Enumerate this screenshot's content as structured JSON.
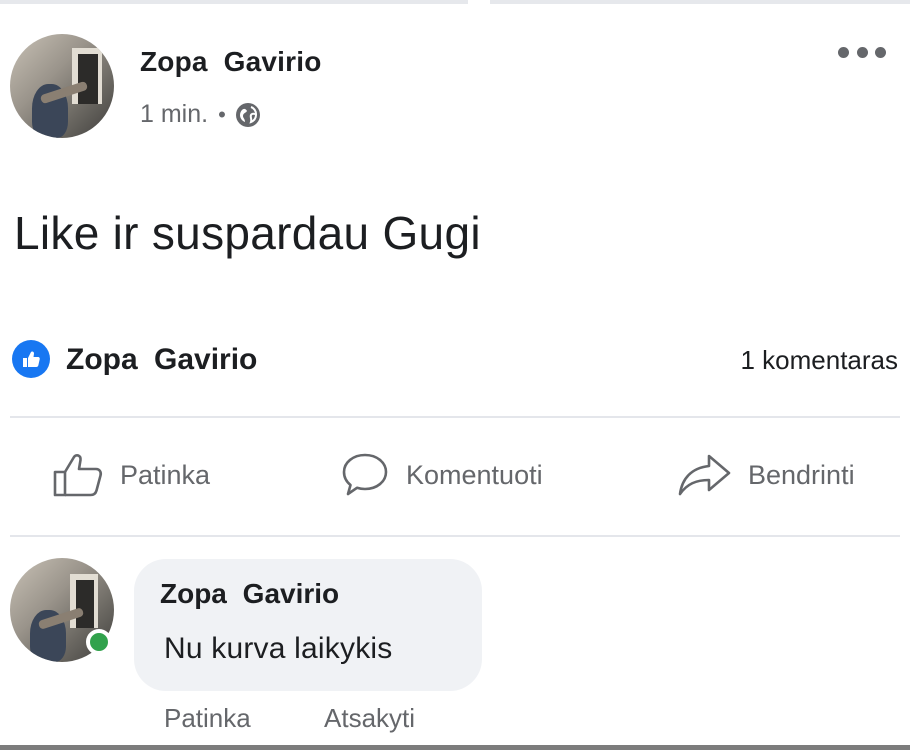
{
  "post": {
    "author": "Zopa Gavirio",
    "time": "1 min.",
    "separator": "•",
    "privacy_icon": "globe-icon",
    "text": "Like ir suspardau Gugi",
    "more_icon": "more-options-icon"
  },
  "reactions": {
    "icon": "like-badge-icon",
    "names": "Zopa Gavirio",
    "comment_count": "1 komentaras"
  },
  "actions": {
    "like_label": "Patinka",
    "comment_label": "Komentuoti",
    "share_label": "Bendrinti"
  },
  "comment": {
    "author": "Zopa Gavirio",
    "text": "Nu kurva laikykis",
    "like_label": "Patinka",
    "reply_label": "Atsakyti",
    "online": true
  },
  "colors": {
    "brand_blue": "#1877f2",
    "secondary_text": "#65676b",
    "bubble_bg": "#f0f2f5",
    "online_green": "#31a24c"
  }
}
